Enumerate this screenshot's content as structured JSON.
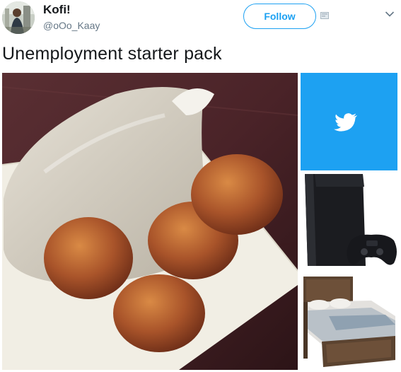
{
  "tweet": {
    "display_name": "Kofi!",
    "handle": "@oOo_Kaay",
    "follow_label": "Follow",
    "text": "Unemployment starter pack"
  },
  "icons": {
    "block": "block-icon",
    "menu": "chevron-down-icon",
    "twitter": "twitter-bird-icon"
  },
  "colors": {
    "accent": "#1da1f2",
    "text": "#14171a",
    "muted": "#657786"
  }
}
